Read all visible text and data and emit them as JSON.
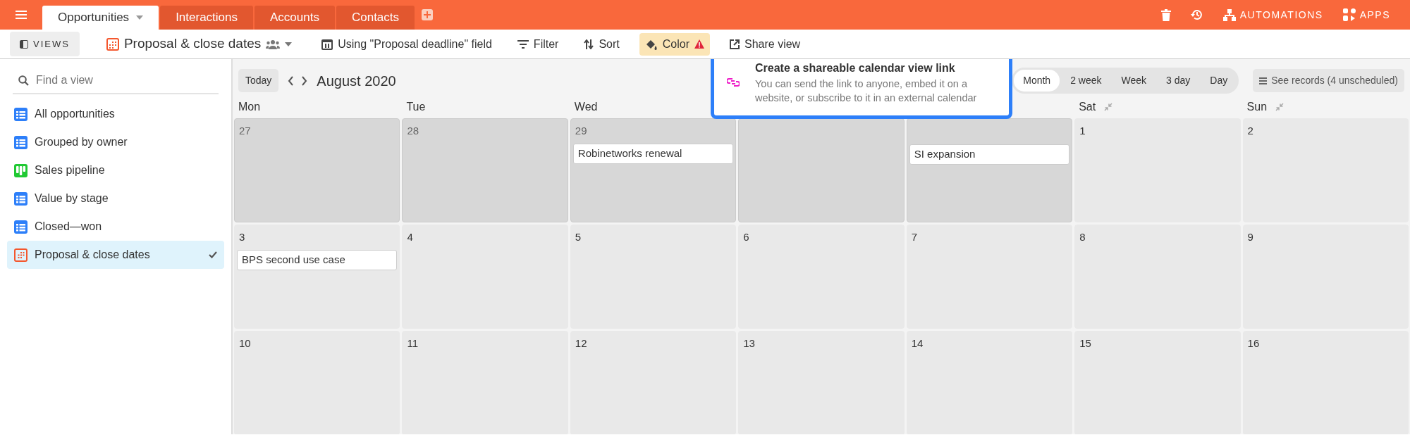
{
  "top_bar": {
    "tabs": [
      {
        "label": "Opportunities",
        "selected": true
      },
      {
        "label": "Interactions",
        "selected": false
      },
      {
        "label": "Accounts",
        "selected": false
      },
      {
        "label": "Contacts",
        "selected": false
      }
    ],
    "actions": [
      "AUTOMATIONS",
      "APPS"
    ]
  },
  "toolbar": {
    "views_button": "VIEWS",
    "view_name": "Proposal & close dates",
    "date_field": "Using \"Proposal deadline\" field",
    "filter": "Filter",
    "sort": "Sort",
    "color_button": "Color",
    "share": "Share view"
  },
  "sidebar": {
    "search_placeholder": "Find a view",
    "items": [
      {
        "label": "All opportunities",
        "kind": "grid",
        "selected": false
      },
      {
        "label": "Grouped by owner",
        "kind": "grid",
        "selected": false
      },
      {
        "label": "Sales pipeline",
        "kind": "kanban",
        "selected": false
      },
      {
        "label": "Value by stage",
        "kind": "grid",
        "selected": false
      },
      {
        "label": "Closed—won",
        "kind": "grid",
        "selected": false
      },
      {
        "label": "Proposal & close dates",
        "kind": "calendar",
        "selected": true
      }
    ]
  },
  "calendar": {
    "today": "Today",
    "month": "August 2020",
    "ranges": [
      {
        "label": "Month",
        "selected": true
      },
      {
        "label": "2 week",
        "selected": false
      },
      {
        "label": "Week",
        "selected": false
      },
      {
        "label": "3 day",
        "selected": false
      },
      {
        "label": "Day",
        "selected": false
      }
    ],
    "see_records": "See records (4 unscheduled)",
    "weekdays": {
      "workdays": [
        "Mon",
        "Tue",
        "Wed"
      ],
      "weekend": [
        "Sat",
        "Sun"
      ]
    },
    "weeks": [
      [
        {
          "date": "27",
          "outside": true
        },
        {
          "date": "28",
          "outside": true
        },
        {
          "date": "29",
          "outside": true,
          "events": [
            "Robinetworks renewal"
          ]
        },
        {
          "outside": true
        },
        {
          "outside": true,
          "events": [
            "SI expansion"
          ]
        },
        {
          "date": "1",
          "outside": false
        },
        {
          "date": "2",
          "outside": false
        }
      ],
      [
        {
          "date": "3",
          "outside": false,
          "events": [
            "BPS second use case"
          ]
        },
        {
          "date": "4",
          "outside": false
        },
        {
          "date": "5",
          "outside": false
        },
        {
          "date": "6",
          "outside": false
        },
        {
          "date": "7",
          "outside": false
        },
        {
          "date": "8",
          "outside": false
        },
        {
          "date": "9",
          "outside": false
        }
      ],
      [
        {
          "date": "10",
          "outside": false
        },
        {
          "date": "11",
          "outside": false
        },
        {
          "date": "12",
          "outside": false
        },
        {
          "date": "13",
          "outside": false
        },
        {
          "date": "14",
          "outside": false
        },
        {
          "date": "15",
          "outside": false
        },
        {
          "date": "16",
          "outside": false
        }
      ]
    ]
  },
  "popup": {
    "title": "Create a shareable calendar view link",
    "body": "You can send the link to anyone, embed it on a website, or subscribe to it in an external calendar"
  }
}
